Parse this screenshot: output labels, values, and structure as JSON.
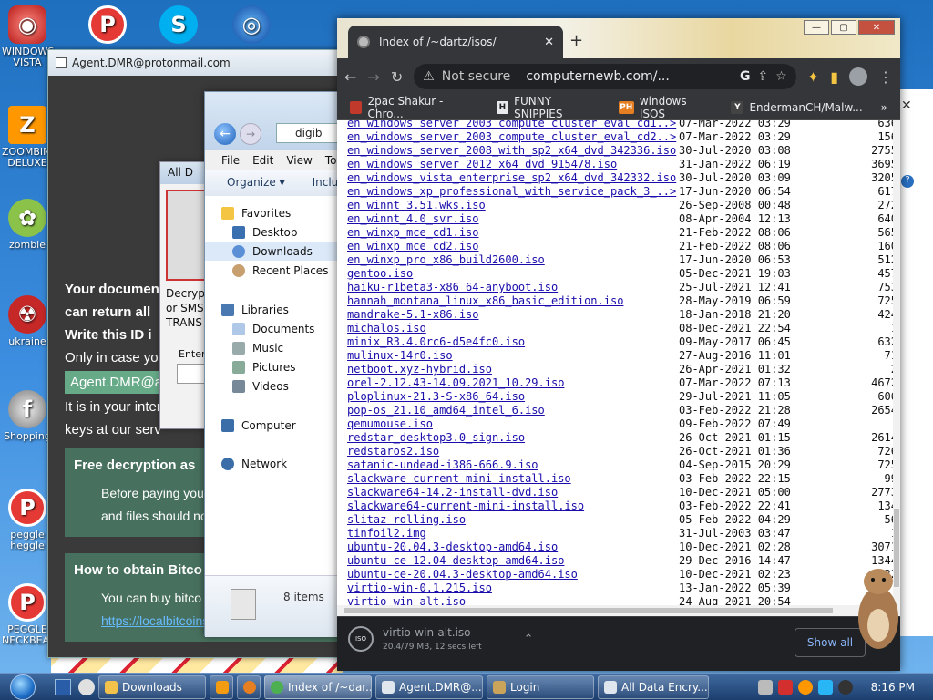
{
  "desktop": {
    "icons": [
      {
        "label": "WINDOWS\nVISTA",
        "name": "windows-vista"
      },
      {
        "label": "ZOOMBINI\nDELUXE",
        "name": "zoom-deluxe"
      },
      {
        "label": "zombie",
        "name": "zombie"
      },
      {
        "label": "ukraine",
        "name": "ukraine"
      },
      {
        "label": "Shopping",
        "name": "shopping"
      },
      {
        "label": "peggle\nheggle",
        "name": "peggle-heggle"
      },
      {
        "label": "PEGGLE\nNECKBEARD",
        "name": "peggle-neckbeard"
      }
    ]
  },
  "ransom": {
    "title": "Agent.DMR@protonmail.com",
    "line1": "Your document",
    "line2": "can return all",
    "line3": "Write this ID i",
    "line4": "Only in case you",
    "id_value": "Agent.DMR@ac",
    "line5": "It is in your inter",
    "line6": "keys at our serv",
    "panel1_title": "Free decryption as",
    "panel1_line1": "Before paying you",
    "panel1_line2": "and files should no",
    "panel2_title": "How to obtain Bitco",
    "panel2_line1": "You can buy bitco",
    "panel2_link": "https://localbitcoins.com/buy_bitcoins"
  },
  "alldata": {
    "title": "All D",
    "text1": "Decryp",
    "text2": "or SMS",
    "text3": "TRANS",
    "enter": "Enter"
  },
  "explorer": {
    "address": "digib",
    "menu": [
      "File",
      "Edit",
      "View",
      "Too"
    ],
    "organize": "Organize ▾",
    "include": "Inclu",
    "favorites": "Favorites",
    "nav": [
      "Desktop",
      "Downloads",
      "Recent Places"
    ],
    "libraries": "Libraries",
    "lib_items": [
      "Documents",
      "Music",
      "Pictures",
      "Videos"
    ],
    "computer": "Computer",
    "network": "Network",
    "status": "8 items"
  },
  "chrome": {
    "tab_title": "Index of /~dartz/isos/",
    "omnibox": {
      "security": "Not secure",
      "url": "computernewb.com/..."
    },
    "bookmarks": [
      {
        "label": "2pac Shakur - Chro...",
        "color": "#c0392b"
      },
      {
        "label": "FUNNY SNIPPIES",
        "color": "#e8eaed",
        "fav": "H"
      },
      {
        "label": "windows ISOS",
        "color": "#e67e22",
        "fav": "PH"
      },
      {
        "label": "EndermanCH/Malw...",
        "color": "#444",
        "fav": "Y"
      }
    ],
    "files": [
      {
        "name": "en_windows_server_2003_compute_cluster_eval_cd1..>",
        "date": "07-Mar-2022 03:29",
        "size": "636"
      },
      {
        "name": "en_windows_server_2003_compute_cluster_eval_cd2..>",
        "date": "07-Mar-2022 03:29",
        "size": "156"
      },
      {
        "name": "en_windows_server_2008_with_sp2_x64_dvd_342336.iso",
        "date": "30-Jul-2020 03:08",
        "size": "2755"
      },
      {
        "name": "en_windows_server_2012_x64_dvd_915478.iso",
        "date": "31-Jan-2022 06:19",
        "size": "3695"
      },
      {
        "name": "en_windows_vista_enterprise_sp2_x64_dvd_342332.iso",
        "date": "30-Jul-2020 03:09",
        "size": "3205"
      },
      {
        "name": "en_windows_xp_professional_with_service_pack_3_..>",
        "date": "17-Jun-2020 06:54",
        "size": "617"
      },
      {
        "name": "en_winnt_3.51.wks.iso",
        "date": "26-Sep-2008 00:48",
        "size": "272"
      },
      {
        "name": "en_winnt_4.0_svr.iso",
        "date": "08-Apr-2004 12:13",
        "size": "640"
      },
      {
        "name": "en_winxp_mce_cd1.iso",
        "date": "21-Feb-2022 08:06",
        "size": "565"
      },
      {
        "name": "en_winxp_mce_cd2.iso",
        "date": "21-Feb-2022 08:06",
        "size": "160"
      },
      {
        "name": "en_winxp_pro_x86_build2600.iso",
        "date": "17-Jun-2020 06:53",
        "size": "512"
      },
      {
        "name": "gentoo.iso",
        "date": "05-Dec-2021 19:03",
        "size": "457"
      },
      {
        "name": "haiku-r1beta3-x86_64-anyboot.iso",
        "date": "25-Jul-2021 12:41",
        "size": "753"
      },
      {
        "name": "hannah_montana_linux_x86_basic_edition.iso",
        "date": "28-May-2019 06:59",
        "size": "725"
      },
      {
        "name": "mandrake-5.1-x86.iso",
        "date": "18-Jan-2018 21:20",
        "size": "424"
      },
      {
        "name": "michalos.iso",
        "date": "08-Dec-2021 22:54",
        "size": "1"
      },
      {
        "name": "minix_R3.4.0rc6-d5e4fc0.iso",
        "date": "09-May-2017 06:45",
        "size": "632"
      },
      {
        "name": "mulinux-14r0.iso",
        "date": "27-Aug-2016 11:01",
        "size": "71"
      },
      {
        "name": "netboot.xyz-hybrid.iso",
        "date": "26-Apr-2021 01:32",
        "size": "2"
      },
      {
        "name": "orel-2.12.43-14.09.2021_10.29.iso",
        "date": "07-Mar-2022 07:13",
        "size": "4672"
      },
      {
        "name": "ploplinux-21.3-S-x86_64.iso",
        "date": "29-Jul-2021 11:05",
        "size": "606"
      },
      {
        "name": "pop-os_21.10_amd64_intel_6.iso",
        "date": "03-Feb-2022 21:28",
        "size": "2654"
      },
      {
        "name": "qemumouse.iso",
        "date": "09-Feb-2022 07:49",
        "size": ""
      },
      {
        "name": "redstar_desktop3.0_sign.iso",
        "date": "26-Oct-2021 01:15",
        "size": "2614"
      },
      {
        "name": "redstaros2.iso",
        "date": "26-Oct-2021 01:36",
        "size": "726"
      },
      {
        "name": "satanic-undead-i386-666.9.iso",
        "date": "04-Sep-2015 20:29",
        "size": "725"
      },
      {
        "name": "slackware-current-mini-install.iso",
        "date": "03-Feb-2022 22:15",
        "size": "99"
      },
      {
        "name": "slackware64-14.2-install-dvd.iso",
        "date": "10-Dec-2021 05:00",
        "size": "2773"
      },
      {
        "name": "slackware64-current-mini-install.iso",
        "date": "03-Feb-2022 22:41",
        "size": "134"
      },
      {
        "name": "slitaz-rolling.iso",
        "date": "05-Feb-2022 04:29",
        "size": "56"
      },
      {
        "name": "tinfoil2.img",
        "date": "31-Jul-2003 03:47",
        "size": "1"
      },
      {
        "name": "ubuntu-20.04.3-desktop-amd64.iso",
        "date": "10-Dec-2021 02:28",
        "size": "3071"
      },
      {
        "name": "ubuntu-ce-12.04-desktop-amd64.iso",
        "date": "29-Dec-2016 14:47",
        "size": "1344"
      },
      {
        "name": "ubuntu-ce-20.04.3-desktop-amd64.iso",
        "date": "10-Dec-2021 02:23",
        "size": "32"
      },
      {
        "name": "virtio-win-0.1.215.iso",
        "date": "13-Jan-2022 05:39",
        "size": ""
      },
      {
        "name": "virtio-win-alt.iso",
        "date": "24-Aug-2021 20:54",
        "size": ""
      }
    ],
    "download": {
      "file": "virtio-win-alt.iso",
      "progress": "20.4/79 MB, 12 secs left",
      "icon_text": "ISO"
    },
    "show_all": "Show all"
  },
  "taskbar": {
    "buttons": [
      {
        "label": "Downloads",
        "color": "#f3c24a"
      },
      {
        "label": "Index of /~dar...",
        "color": "#4caf50",
        "active": true
      },
      {
        "label": "Agent.DMR@...",
        "color": "#dfe6ee"
      },
      {
        "label": "Login",
        "color": "#c9a45a"
      },
      {
        "label": "All Data Encry...",
        "color": "#dfe6ee"
      }
    ],
    "clock": "8:16 PM"
  },
  "colors": {
    "chrome_dark": "#35363a",
    "link": "#1a0dab",
    "ransom_panel": "#48705e"
  }
}
